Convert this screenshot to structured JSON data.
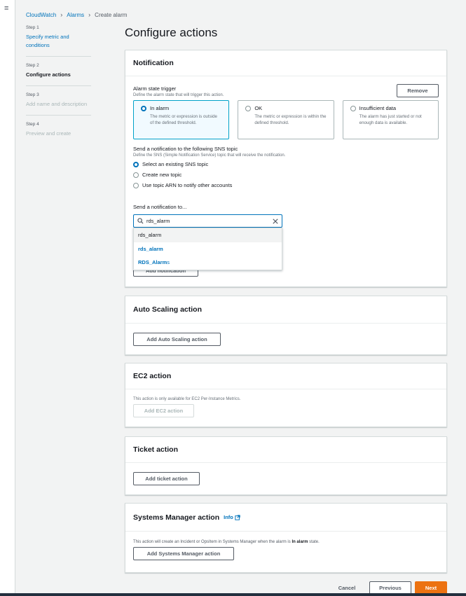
{
  "breadcrumb": {
    "item1": "CloudWatch",
    "item2": "Alarms",
    "current": "Create alarm"
  },
  "steps": [
    {
      "num": "Step 1",
      "label": "Specify metric and conditions"
    },
    {
      "num": "Step 2",
      "label": "Configure actions"
    },
    {
      "num": "Step 3",
      "label": "Add name and description"
    },
    {
      "num": "Step 4",
      "label": "Preview and create"
    }
  ],
  "page_title": "Configure actions",
  "notification": {
    "title": "Notification",
    "remove_label": "Remove",
    "trigger_label": "Alarm state trigger",
    "trigger_desc": "Define the alarm state that will trigger this action.",
    "tiles": [
      {
        "title": "In alarm",
        "desc": "The metric or expression is outside of the defined threshold."
      },
      {
        "title": "OK",
        "desc": "The metric or expression is within the defined threshold."
      },
      {
        "title": "Insufficient data",
        "desc": "The alarm has just started or not enough data is available."
      }
    ],
    "sns_label": "Send a notification to the following SNS topic",
    "sns_desc": "Define the SNS (Simple Notification Service) topic that will receive the notification.",
    "sns_options": [
      "Select an existing SNS topic",
      "Create new topic",
      "Use topic ARN to notify other accounts"
    ],
    "send_to_label": "Send a notification to...",
    "search_value": "rds_alarm",
    "dropdown": {
      "filter_text": "rds_alarm",
      "options": [
        {
          "match": "rds_alarm",
          "rest": ""
        },
        {
          "match": "RDS_Alarm",
          "rest": "s"
        }
      ]
    },
    "add_label": "Add notification"
  },
  "auto_scaling": {
    "title": "Auto Scaling action",
    "button": "Add Auto Scaling action"
  },
  "ec2": {
    "title": "EC2 action",
    "desc": "This action is only available for EC2 Per-Instance Metrics.",
    "button": "Add EC2 action"
  },
  "ticket": {
    "title": "Ticket action",
    "button": "Add ticket action"
  },
  "ssm": {
    "title": "Systems Manager action",
    "info": "Info",
    "desc_pre": "This action will create an Incident or OpsItem in Systems Manager when the alarm is ",
    "desc_bold": "In alarm",
    "desc_post": " state.",
    "button": "Add Systems Manager action"
  },
  "footer": {
    "cancel": "Cancel",
    "previous": "Previous",
    "next": "Next"
  }
}
